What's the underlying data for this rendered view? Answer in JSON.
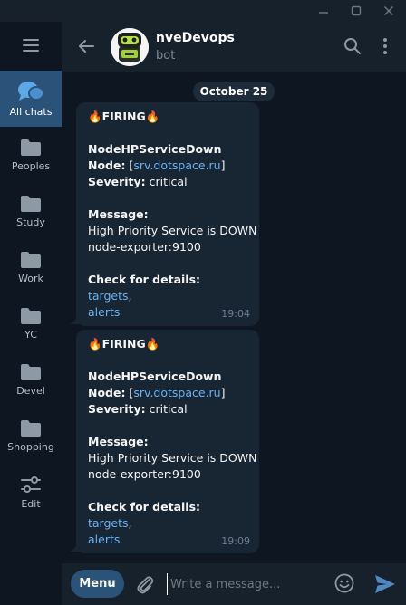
{
  "sidebar": {
    "items": [
      {
        "label": "All chats",
        "icon": "chat-bubbles-icon",
        "active": true
      },
      {
        "label": "Peoples",
        "icon": "folder-icon"
      },
      {
        "label": "Study",
        "icon": "folder-icon"
      },
      {
        "label": "Work",
        "icon": "folder-icon"
      },
      {
        "label": "YC",
        "icon": "folder-icon"
      },
      {
        "label": "Devel",
        "icon": "folder-icon"
      },
      {
        "label": "Shopping",
        "icon": "folder-icon"
      },
      {
        "label": "Edit",
        "icon": "sliders-icon"
      }
    ]
  },
  "header": {
    "title": "nveDevops",
    "subtitle": "bot"
  },
  "date_separator": "October 25",
  "messages": [
    {
      "heading": "🔥FIRING🔥",
      "alertname": "NodeHPServiceDown",
      "node_label": "Node:",
      "node_bracket_open": "[",
      "node_link": "srv.dotspace.ru",
      "node_bracket_close": "]",
      "severity_label": "Severity:",
      "severity_value": "critical",
      "message_label": "Message:",
      "message_line1": "High Priority Service is DOWN",
      "message_line2": "node-exporter:9100",
      "details_label": "Check for details:",
      "link_targets": "targets",
      "comma": ",",
      "link_alerts": "alerts",
      "time": "19:04"
    },
    {
      "heading": "🔥FIRING🔥",
      "alertname": "NodeHPServiceDown",
      "node_label": "Node:",
      "node_bracket_open": "[",
      "node_link": "srv.dotspace.ru",
      "node_bracket_close": "]",
      "severity_label": "Severity:",
      "severity_value": "critical",
      "message_label": "Message:",
      "message_line1": "High Priority Service is DOWN",
      "message_line2": "node-exporter:9100",
      "details_label": "Check for details:",
      "link_targets": "targets",
      "comma": ",",
      "link_alerts": "alerts",
      "time": "19:09"
    }
  ],
  "composer": {
    "menu_label": "Menu",
    "placeholder": "Write a message..."
  },
  "colors": {
    "background": "#0e1621",
    "panel": "#17212b",
    "bubble": "#182533",
    "accent": "#2b5278",
    "link": "#6ab2f2",
    "send": "#5288c1"
  }
}
